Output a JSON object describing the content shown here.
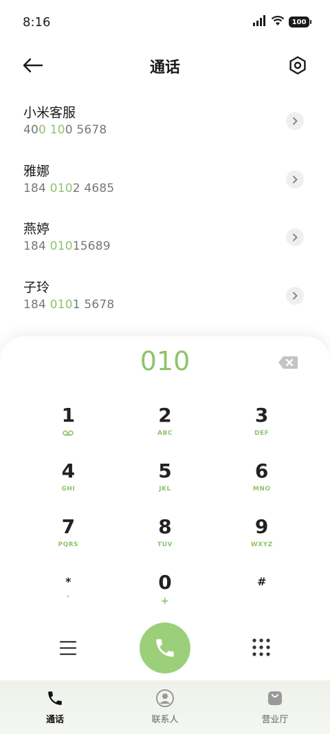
{
  "status": {
    "time": "8:16",
    "battery": "100"
  },
  "header": {
    "title": "通话"
  },
  "contacts": [
    {
      "name": "小米客服",
      "pre": "40",
      "hl1": "0",
      "mid": " ",
      "hl2": "10",
      "post": "0 5678"
    },
    {
      "name": "雅娜",
      "pre": "184 ",
      "hl1": "010",
      "mid": "",
      "hl2": "",
      "post": "2 4685"
    },
    {
      "name": "燕婷",
      "pre": "184 ",
      "hl1": "010",
      "mid": "",
      "hl2": "",
      "post": "15689"
    },
    {
      "name": "子玲",
      "pre": "184 ",
      "hl1": "010",
      "mid": "",
      "hl2": "",
      "post": "1 5678"
    }
  ],
  "dialer": {
    "input": "010",
    "keys": [
      {
        "d": "1",
        "s": "voicemail"
      },
      {
        "d": "2",
        "s": "ABC"
      },
      {
        "d": "3",
        "s": "DEF"
      },
      {
        "d": "4",
        "s": "GHI"
      },
      {
        "d": "5",
        "s": "JKL"
      },
      {
        "d": "6",
        "s": "MNO"
      },
      {
        "d": "7",
        "s": "PQRS"
      },
      {
        "d": "8",
        "s": "TUV"
      },
      {
        "d": "9",
        "s": "WXYZ"
      },
      {
        "d": "*",
        "s": ","
      },
      {
        "d": "0",
        "s": "+"
      },
      {
        "d": "#",
        "s": ""
      }
    ]
  },
  "nav": {
    "calls": "通话",
    "contacts": "联系人",
    "store": "营业厅"
  },
  "colors": {
    "accent": "#8ec36a",
    "call_button": "#9ccf7a"
  }
}
